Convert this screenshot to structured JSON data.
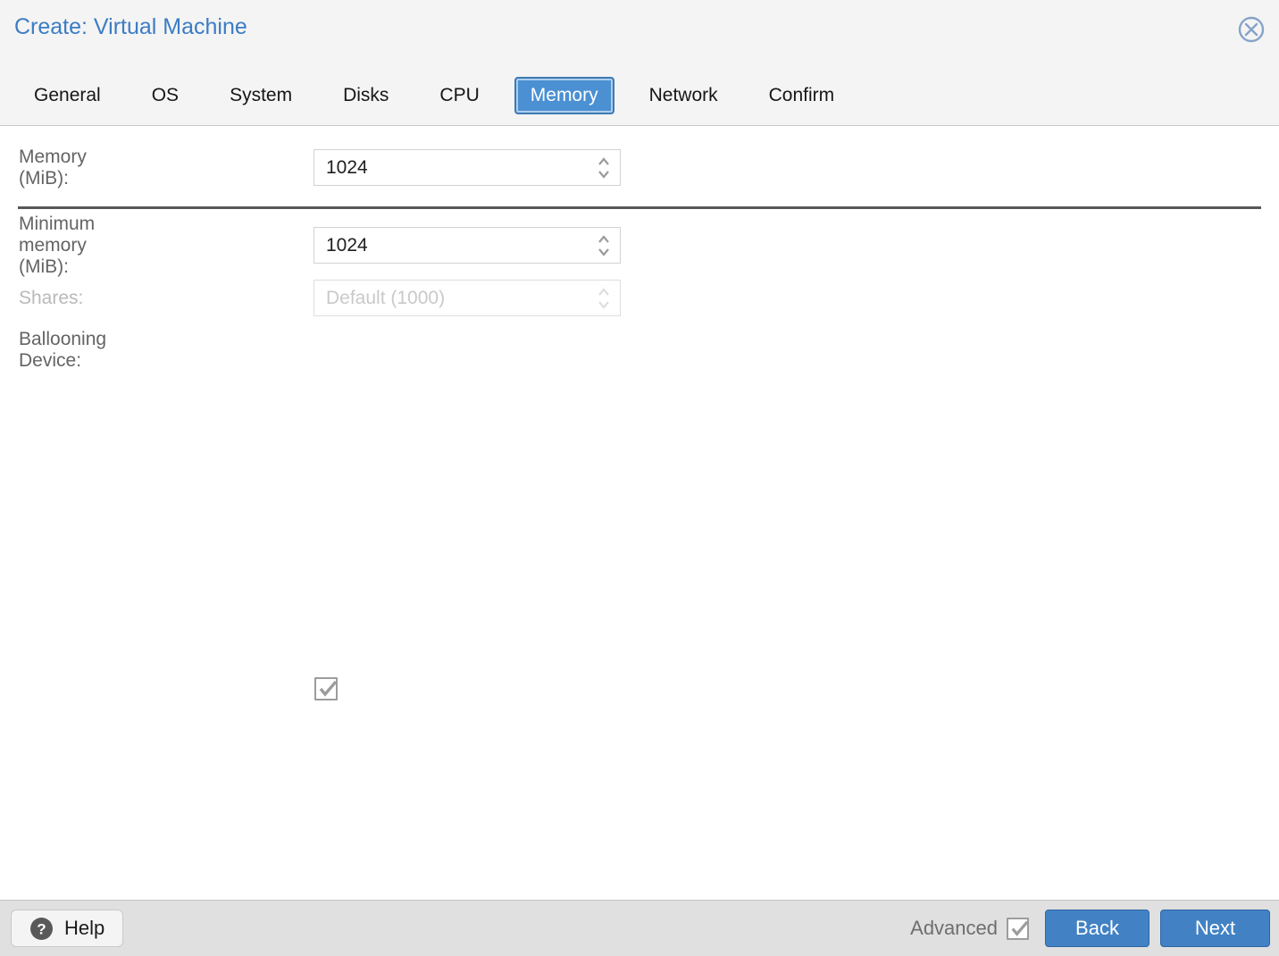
{
  "dialog": {
    "title": "Create: Virtual Machine",
    "close_icon": "close-circle-icon"
  },
  "tabs": {
    "active": "Memory",
    "items": [
      {
        "label": "General"
      },
      {
        "label": "OS"
      },
      {
        "label": "System"
      },
      {
        "label": "Disks"
      },
      {
        "label": "CPU"
      },
      {
        "label": "Memory"
      },
      {
        "label": "Network"
      },
      {
        "label": "Confirm"
      }
    ]
  },
  "form": {
    "rows": [
      {
        "label": "Memory (MiB):",
        "value": "1024",
        "control": "number-spinner",
        "enabled": true
      },
      {
        "label": "Minimum memory (MiB):",
        "value": "1024",
        "control": "number-spinner",
        "enabled": true
      },
      {
        "label": "Shares:",
        "value": "Default (1000)",
        "control": "number-spinner",
        "enabled": false
      },
      {
        "label": "Ballooning Device:",
        "control": "checkbox",
        "checked": true
      }
    ]
  },
  "footer": {
    "help_label": "Help",
    "help_icon": "question-circle-icon",
    "advanced_label": "Advanced",
    "advanced_checked": true,
    "back_label": "Back",
    "next_label": "Next"
  },
  "colors": {
    "title_blue": "#3b7cc4",
    "active_tab_blue": "#4a90d2",
    "button_blue": "#4282c4",
    "button_border_blue": "#2f66a5",
    "header_bg": "#f4f4f4",
    "footer_bg": "#e0e0e0",
    "label_gray": "#646464",
    "disabled_gray": "#c9c9c9",
    "divider_gray": "#585858"
  }
}
